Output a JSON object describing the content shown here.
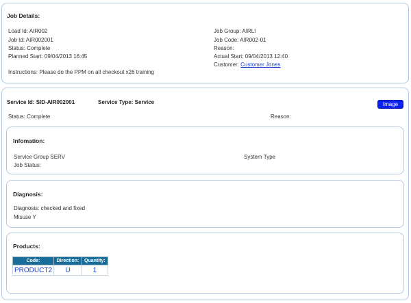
{
  "job_details": {
    "heading": "Job Details:",
    "load_id": "Load Id: AIR002",
    "job_id": "Job Id: AIR002001",
    "status": "Status: Complete",
    "planned_start": "Planned Start: 09/04/2013 16:45",
    "job_group": "Job Group: AIRLI",
    "job_code": "Job Code: AIR002-01",
    "reason": "Reason:",
    "actual_start": "Actual Start: 09/04/2013 12:40",
    "customer_label": "Customer:",
    "customer_link": "Customer Jones",
    "instructions": "Instructions: Please do the PPM on all checkout x26 training"
  },
  "service": {
    "service_id": "Service Id: SID-AIR002001",
    "service_type": "Service Type: Service",
    "image_button": "Image",
    "status": "Status: Complete",
    "reason": "Reason:"
  },
  "information": {
    "heading": "Infomation:",
    "service_group": "Service Group SERV",
    "system_type": "System Type",
    "job_status": "Job Status:"
  },
  "diagnosis": {
    "heading": "Diagnosis:",
    "diagnosis": "Diagnosis: checked and fixed",
    "misuse": "Misuse Y"
  },
  "products": {
    "heading": "Products:",
    "columns": [
      "Code:",
      "Direction:",
      "Quantity:"
    ],
    "rows": [
      [
        "PRODUCT2",
        "U",
        "1"
      ]
    ]
  },
  "colors": {
    "panel_border": "#b3c8e3",
    "table_header": "#1a6c98",
    "link": "#1a3ecc",
    "button": "#0b1ff0"
  }
}
